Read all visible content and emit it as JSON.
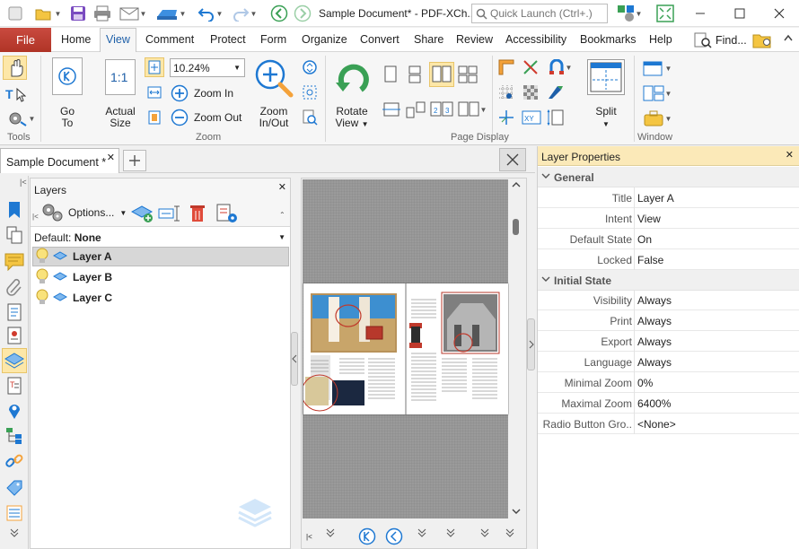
{
  "title_bar": {
    "doc_title": "Sample Document* - PDF-XCh..",
    "quick_launch_placeholder": "Quick Launch (Ctrl+.)"
  },
  "menu": {
    "file": "File",
    "tabs": [
      "Home",
      "View",
      "Comment",
      "Protect",
      "Form",
      "Organize",
      "Convert",
      "Share",
      "Review",
      "Accessibility",
      "Bookmarks",
      "Help"
    ],
    "find": "Find..."
  },
  "ribbon": {
    "tools_group": "Tools",
    "zoom_group": "Zoom",
    "page_display_group": "Page Display",
    "window_group": "Window",
    "go_to_1": "Go",
    "go_to_2": "To",
    "actual_1": "Actual",
    "actual_2": "Size",
    "zoom_value": "10.24%",
    "zoom_in": "Zoom In",
    "zoom_out": "Zoom Out",
    "zoominout_1": "Zoom",
    "zoominout_2": "In/Out",
    "rotate_1": "Rotate",
    "rotate_2": "View",
    "split": "Split"
  },
  "doc_tab": {
    "label": "Sample Document *"
  },
  "layers": {
    "title": "Layers",
    "options": "Options...",
    "default_label": "Default:",
    "default_value": "None",
    "items": [
      "Layer A",
      "Layer B",
      "Layer C"
    ]
  },
  "properties": {
    "title": "Layer Properties",
    "sections": {
      "general": "General",
      "initial": "Initial State"
    },
    "general_rows": [
      {
        "k": "Title",
        "v": "Layer A"
      },
      {
        "k": "Intent",
        "v": "View"
      },
      {
        "k": "Default State",
        "v": "On"
      },
      {
        "k": "Locked",
        "v": "False"
      }
    ],
    "initial_rows": [
      {
        "k": "Visibility",
        "v": "Always"
      },
      {
        "k": "Print",
        "v": "Always"
      },
      {
        "k": "Export",
        "v": "Always"
      },
      {
        "k": "Language",
        "v": "Always"
      },
      {
        "k": "Minimal Zoom",
        "v": "0%"
      },
      {
        "k": "Maximal Zoom",
        "v": "6400%"
      },
      {
        "k": "Radio Button Gro..",
        "v": "<None>"
      }
    ]
  },
  "colors": {
    "accent_blue": "#1e78d2",
    "file_red": "#b7382b",
    "props_header": "#fbe9b8"
  }
}
